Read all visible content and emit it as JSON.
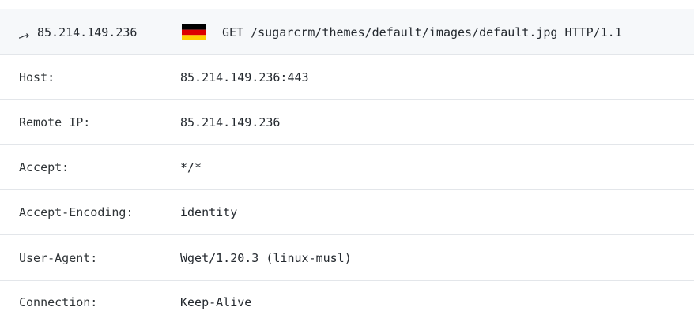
{
  "request": {
    "source_ip": "85.214.149.236",
    "country_flag": "germany-flag-icon",
    "request_line": "GET /sugarcrm/themes/default/images/default.jpg HTTP/1.1"
  },
  "headers": [
    {
      "key": "Host:",
      "value": "85.214.149.236:443"
    },
    {
      "key": "Remote IP:",
      "value": "85.214.149.236"
    },
    {
      "key": "Accept:",
      "value": "*/*"
    },
    {
      "key": "Accept-Encoding:",
      "value": "identity"
    },
    {
      "key": "User-Agent:",
      "value": "Wget/1.20.3 (linux-musl)"
    },
    {
      "key": "Connection:",
      "value": "Keep-Alive"
    }
  ],
  "colors": {
    "header_background": "#f6f8fa",
    "border": "#e3e6ea",
    "text": "#24292f",
    "flag_black": "#000000",
    "flag_red": "#dd0000",
    "flag_gold": "#ffce00"
  }
}
